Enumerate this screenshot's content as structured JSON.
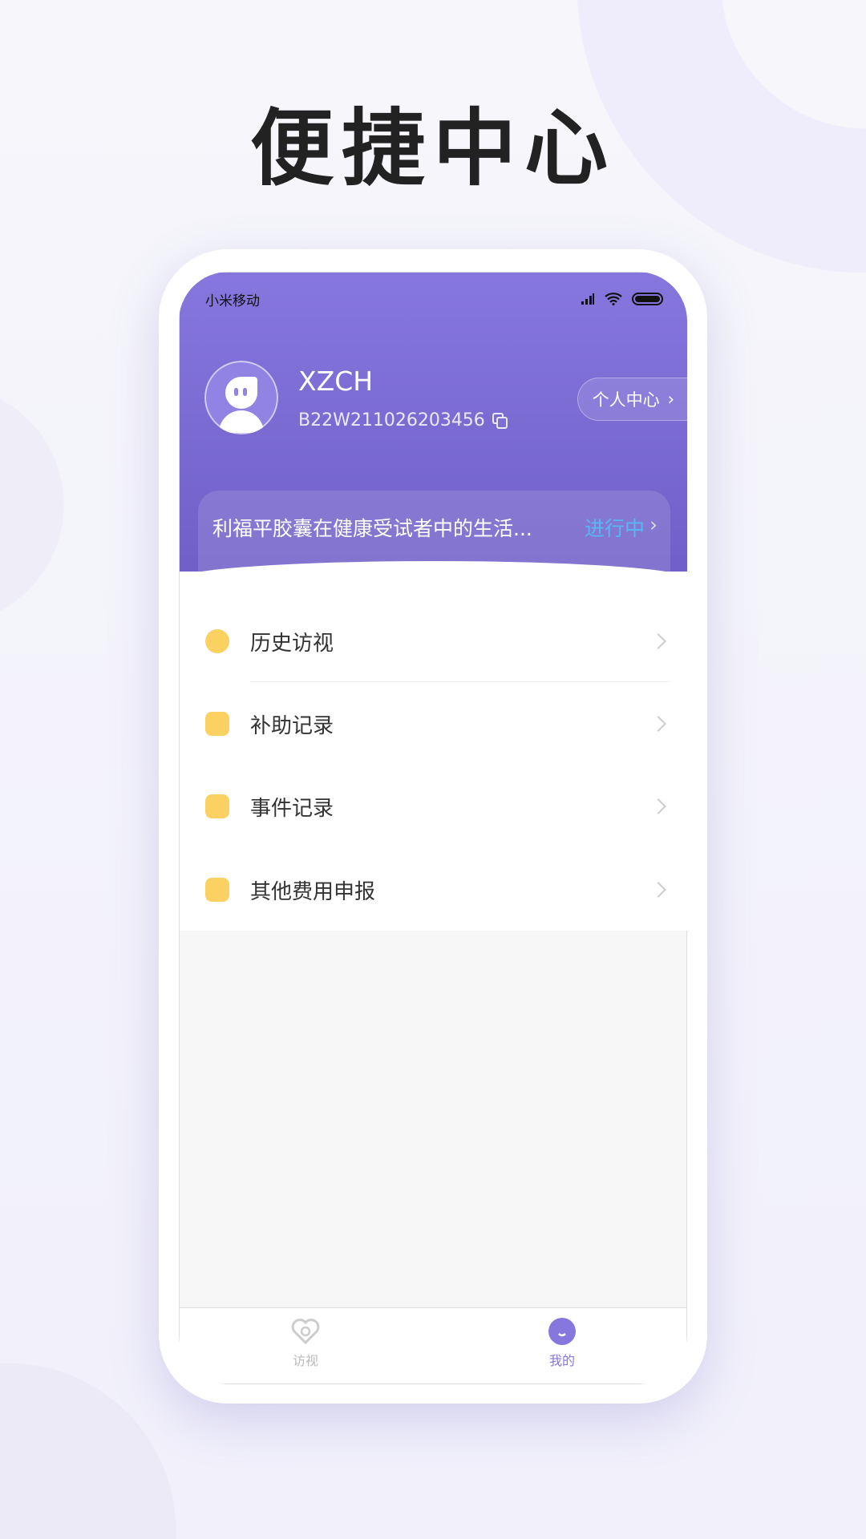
{
  "page_title": "便捷中心",
  "status_bar": {
    "carrier": "小米移动",
    "icons": [
      "signal-icon",
      "wifi-icon",
      "battery-icon"
    ]
  },
  "profile": {
    "name": "XZCH",
    "id": "B22W211026203456",
    "personal_center_label": "个人中心"
  },
  "study": {
    "title": "利福平胶囊在健康受试者中的生活...",
    "status": "进行中"
  },
  "menu": [
    {
      "label": "历史访视",
      "icon": "clock-icon"
    },
    {
      "label": "补助记录",
      "icon": "edit-note-icon"
    },
    {
      "label": "事件记录",
      "icon": "checklist-icon"
    },
    {
      "label": "其他费用申报",
      "icon": "yuan-receipt-icon"
    }
  ],
  "tabs": [
    {
      "label": "访视",
      "icon": "heart-search-icon",
      "active": false
    },
    {
      "label": "我的",
      "icon": "smile-face-icon",
      "active": true
    }
  ],
  "colors": {
    "accent": "#8677de",
    "icon_yellow": "#fbd162",
    "status_blue": "#55b8f5"
  }
}
